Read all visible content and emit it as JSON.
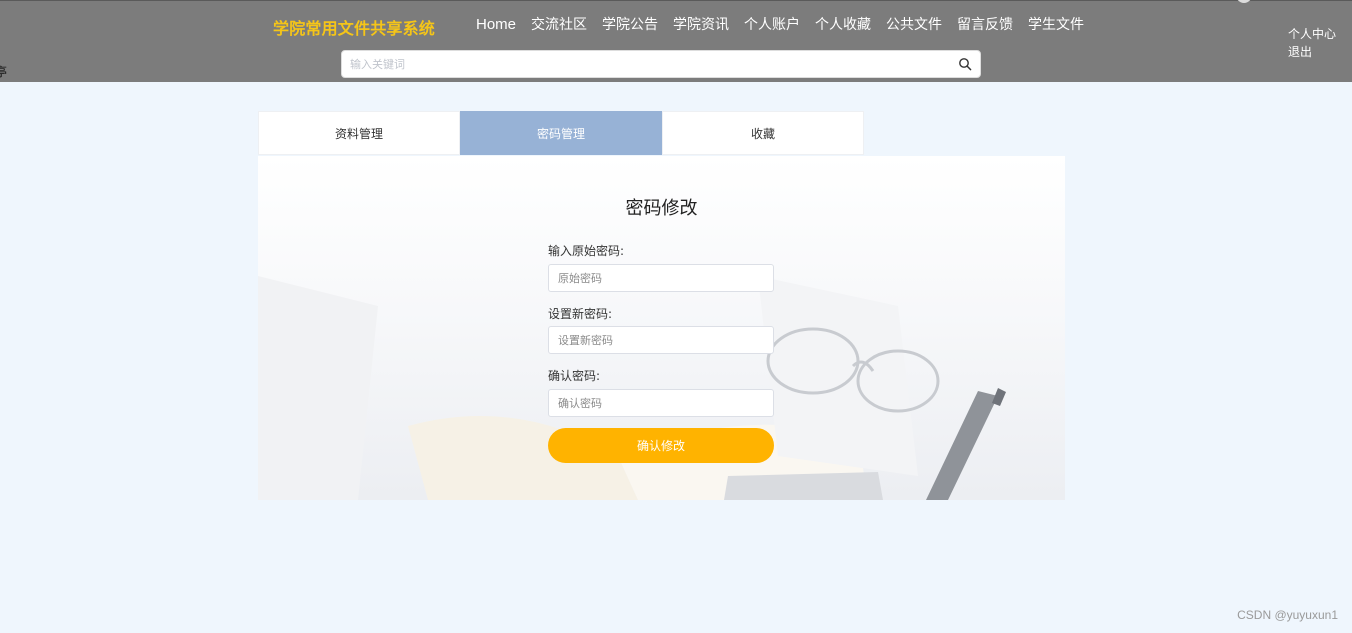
{
  "header": {
    "brand": "学院常用文件共享系统",
    "nav": [
      "Home",
      "交流社区",
      "学院公告",
      "学院资讯",
      "个人账户",
      "个人收藏",
      "公共文件",
      "留言反馈",
      "学生文件"
    ],
    "user_links": [
      "个人中心",
      "退出"
    ],
    "edge_glyph": "亭",
    "search": {
      "placeholder": "输入关键词",
      "icon": "search-icon"
    }
  },
  "tabs": [
    {
      "label": "资料管理",
      "active": false
    },
    {
      "label": "密码管理",
      "active": true
    },
    {
      "label": "收藏",
      "active": false
    }
  ],
  "form": {
    "title": "密码修改",
    "fields": [
      {
        "label": "输入原始密码:",
        "placeholder": "原始密码"
      },
      {
        "label": "设置新密码:",
        "placeholder": "设置新密码"
      },
      {
        "label": "确认密码:",
        "placeholder": "确认密码"
      }
    ],
    "submit_label": "确认修改"
  },
  "watermark": "CSDN @yuyuxun1",
  "colors": {
    "header_bg": "#7c7c7c",
    "brand": "#f5c518",
    "active_tab": "#97b2d6",
    "submit": "#ffb300",
    "page_bg": "#eff6fd"
  }
}
